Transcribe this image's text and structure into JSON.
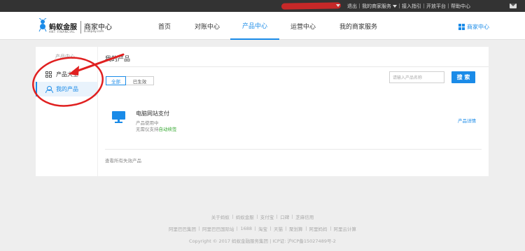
{
  "topbar": {
    "links": [
      "退出",
      "我的商家服务",
      "接入指引",
      "开放平台",
      "帮助中心"
    ]
  },
  "header": {
    "brand_cn": "蚂蚁金服",
    "brand_en": "ANT FINANCIAL",
    "merchant_title": "商家中心",
    "merchant_url": "b.alipay.com",
    "nav": [
      "首页",
      "对账中心",
      "产品中心",
      "运营中心",
      "我的商家服务"
    ],
    "active_nav": "产品中心",
    "merchant_right": "商家中心"
  },
  "sidebar": {
    "title": "产品中心",
    "items": [
      "产品大全",
      "我的产品"
    ],
    "active_item": "我的产品"
  },
  "main": {
    "heading": "我的产品",
    "tabs": [
      "全部",
      "已生效"
    ],
    "active_tab": "全部",
    "search_placeholder": "请输入产品名称",
    "search_button": "搜 索",
    "product": {
      "name": "电脑网站支付",
      "status": "产品使用中",
      "sign_prefix": "无需仪支持",
      "sign_link": "自动续签",
      "detail_link": "产品详情"
    },
    "view_invalid": "查看所有失效产品"
  },
  "footer": {
    "row1": [
      "关于蚂蚁",
      "蚂蚁金服",
      "支付宝",
      "口碑",
      "芝麻信用"
    ],
    "row2": [
      "阿里巴巴集团",
      "阿里巴巴国际站",
      "1688",
      "淘宝",
      "天猫",
      "聚划算",
      "阿里妈妈",
      "阿里云计算"
    ],
    "copyright": "Copyright © 2017 蚂蚁金融服务集团 | ICP证: 沪ICP备15027489号-2"
  },
  "colors": {
    "accent": "#1a8be8",
    "annotation": "#e02020",
    "topbar": "#333333",
    "success": "#3aaa35"
  }
}
